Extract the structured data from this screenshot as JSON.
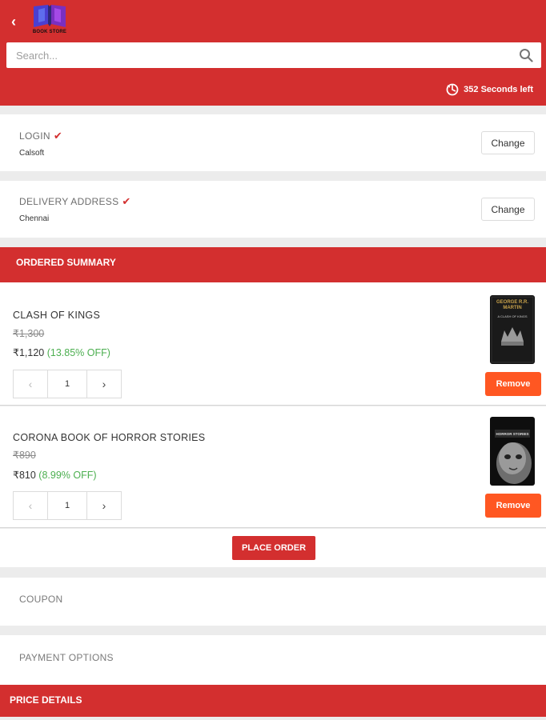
{
  "header": {
    "logo_text": "BOOK STORE",
    "search_placeholder": "Search...",
    "timer_text": "352 Seconds left"
  },
  "checkout_steps": {
    "login": {
      "title": "LOGIN",
      "value": "Calsoft",
      "change_label": "Change"
    },
    "delivery": {
      "title": "DELIVERY ADDRESS",
      "value": "Chennai",
      "change_label": "Change"
    }
  },
  "order_summary": {
    "title": "ORDERED SUMMARY",
    "items": [
      {
        "title": "CLASH OF KINGS",
        "mrp": "₹1,300",
        "price": "₹1,120",
        "discount": "(13.85% OFF)",
        "quantity": "1",
        "remove_label": "Remove",
        "cover_author": "GEORGE R.R. MARTIN",
        "cover_subtitle": "A CLASH OF KINGS"
      },
      {
        "title": "CORONA BOOK OF HORROR STORIES",
        "mrp": "₹890",
        "price": "₹810",
        "discount": "(8.99% OFF)",
        "quantity": "1",
        "remove_label": "Remove",
        "cover_subtitle": "HORROR STORIES"
      }
    ],
    "place_order_label": "PLACE ORDER"
  },
  "options": {
    "coupon_label": "COUPON",
    "payment_label": "PAYMENT OPTIONS"
  },
  "price_details": {
    "title": "PRICE DETAILS"
  },
  "colors": {
    "primary": "#d32f2f",
    "accent": "#ff5722",
    "discount": "#4caf50"
  }
}
